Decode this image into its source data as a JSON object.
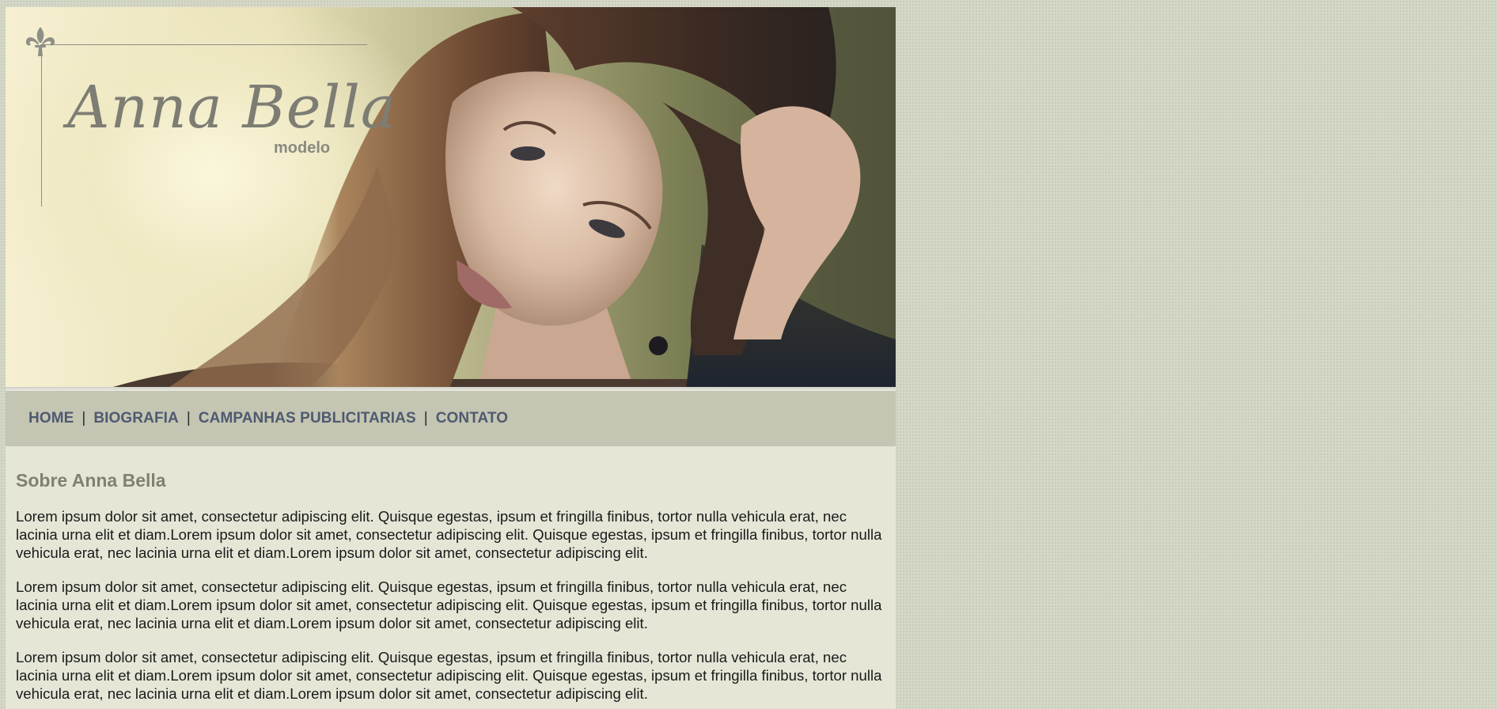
{
  "banner": {
    "logo_name": "Anna Bella",
    "logo_sub": "modelo",
    "logo_icon": "fleur-de-lis-icon"
  },
  "nav": {
    "items": [
      {
        "label": "HOME"
      },
      {
        "label": "BIOGRAFIA"
      },
      {
        "label": "CAMPANHAS PUBLICITARIAS"
      },
      {
        "label": "CONTATO"
      }
    ],
    "separator": "|"
  },
  "content": {
    "heading": "Sobre Anna Bella",
    "paragraphs": [
      "Lorem ipsum dolor sit amet, consectetur adipiscing elit. Quisque egestas, ipsum et fringilla finibus, tortor nulla vehicula erat, nec lacinia urna elit et diam.Lorem ipsum dolor sit amet, consectetur adipiscing elit. Quisque egestas, ipsum et fringilla finibus, tortor nulla vehicula erat, nec lacinia urna elit et diam.Lorem ipsum dolor sit amet, consectetur adipiscing elit.",
      "Lorem ipsum dolor sit amet, consectetur adipiscing elit. Quisque egestas, ipsum et fringilla finibus, tortor nulla vehicula erat, nec lacinia urna elit et diam.Lorem ipsum dolor sit amet, consectetur adipiscing elit. Quisque egestas, ipsum et fringilla finibus, tortor nulla vehicula erat, nec lacinia urna elit et diam.Lorem ipsum dolor sit amet, consectetur adipiscing elit.",
      "Lorem ipsum dolor sit amet, consectetur adipiscing elit. Quisque egestas, ipsum et fringilla finibus, tortor nulla vehicula erat, nec lacinia urna elit et diam.Lorem ipsum dolor sit amet, consectetur adipiscing elit. Quisque egestas, ipsum et fringilla finibus, tortor nulla vehicula erat, nec lacinia urna elit et diam.Lorem ipsum dolor sit amet, consectetur adipiscing elit."
    ]
  },
  "colors": {
    "page_background": "#d3d5c4",
    "content_background": "#e5e6d6",
    "nav_background": "#c4c5b2",
    "nav_link": "#4e5a70",
    "heading": "#818171",
    "body_text": "#1a1a1a"
  }
}
